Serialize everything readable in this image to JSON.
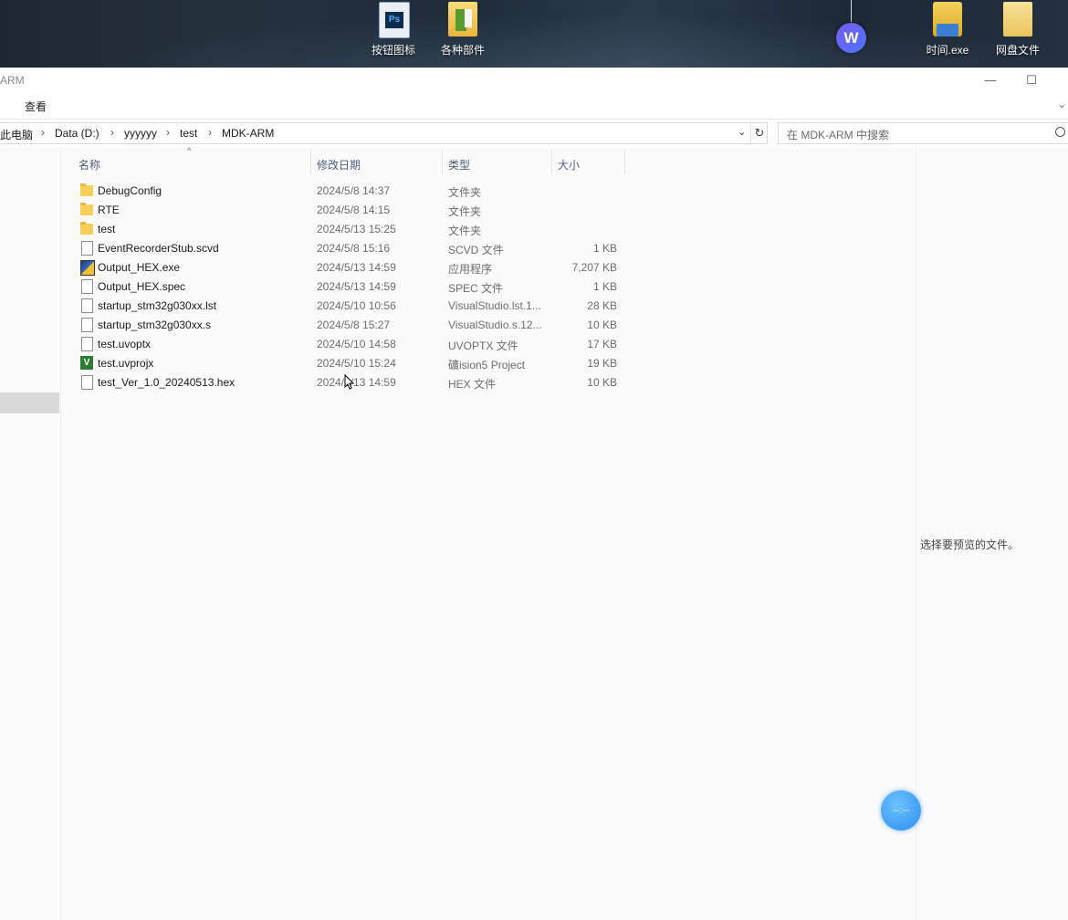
{
  "desktop": {
    "icons": [
      {
        "label": "按钮图标",
        "icon": "photoshop-file-icon"
      },
      {
        "label": "各种部件",
        "icon": "folder-icon"
      },
      {
        "label": "时间.exe",
        "icon": "exe-icon"
      },
      {
        "label": "网盘文件",
        "icon": "folder-icon"
      }
    ],
    "badge_letter": "W"
  },
  "window": {
    "title": "ARM",
    "minimize": "—",
    "maximize": "☐"
  },
  "ribbon": {
    "view_tab": "查看",
    "expand": "⌄"
  },
  "address": {
    "crumbs": [
      "此电脑",
      "Data (D:)",
      "yyyyyy",
      "test",
      "MDK-ARM"
    ],
    "separator": "›",
    "dropdown": "⌄",
    "refresh": "↻"
  },
  "search": {
    "placeholder": "在 MDK-ARM 中搜索"
  },
  "columns": {
    "name": "名称",
    "date": "修改日期",
    "type": "类型",
    "size": "大小"
  },
  "files": [
    {
      "name": "DebugConfig",
      "date": "2024/5/8 14:37",
      "type": "文件夹",
      "size": "",
      "icon": "folder"
    },
    {
      "name": "RTE",
      "date": "2024/5/8 14:15",
      "type": "文件夹",
      "size": "",
      "icon": "folder"
    },
    {
      "name": "test",
      "date": "2024/5/13 15:25",
      "type": "文件夹",
      "size": "",
      "icon": "folder"
    },
    {
      "name": "EventRecorderStub.scvd",
      "date": "2024/5/8 15:16",
      "type": "SCVD 文件",
      "size": "1 KB",
      "icon": "file"
    },
    {
      "name": "Output_HEX.exe",
      "date": "2024/5/13 14:59",
      "type": "应用程序",
      "size": "7,207 KB",
      "icon": "exe"
    },
    {
      "name": "Output_HEX.spec",
      "date": "2024/5/13 14:59",
      "type": "SPEC 文件",
      "size": "1 KB",
      "icon": "file"
    },
    {
      "name": "startup_stm32g030xx.lst",
      "date": "2024/5/10 10:56",
      "type": "VisualStudio.lst.1...",
      "size": "28 KB",
      "icon": "file"
    },
    {
      "name": "startup_stm32g030xx.s",
      "date": "2024/5/8 15:27",
      "type": "VisualStudio.s.12...",
      "size": "10 KB",
      "icon": "file"
    },
    {
      "name": "test.uvoptx",
      "date": "2024/5/10 14:58",
      "type": "UVOPTX 文件",
      "size": "17 KB",
      "icon": "file"
    },
    {
      "name": "test.uvprojx",
      "date": "2024/5/10 15:24",
      "type": "礦ision5 Project",
      "size": "19 KB",
      "icon": "uvision"
    },
    {
      "name": "test_Ver_1.0_20240513.hex",
      "date": "2024/5/13 14:59",
      "type": "HEX 文件",
      "size": "10 KB",
      "icon": "file"
    }
  ],
  "preview": {
    "message": "选择要预览的文件。"
  },
  "floating": {
    "label": "--:--"
  }
}
